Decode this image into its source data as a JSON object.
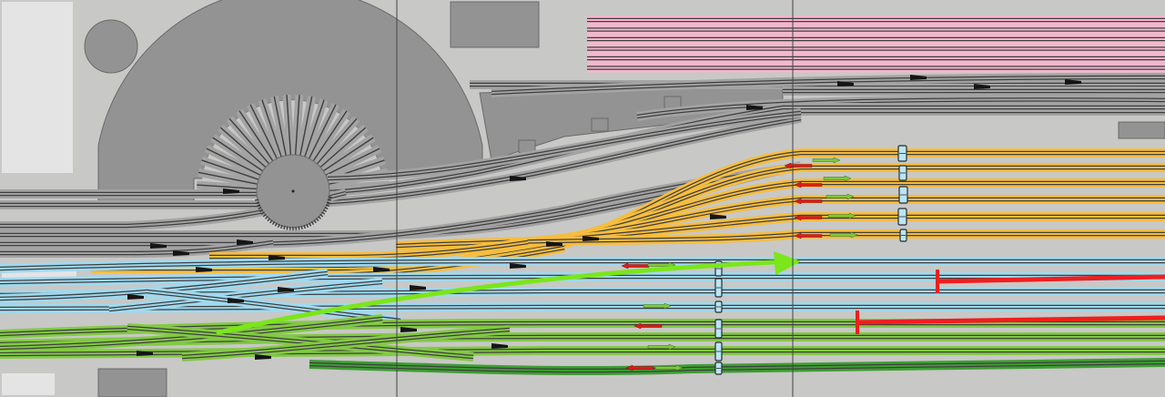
{
  "colors": {
    "background": "#c8c8c6",
    "building": "#939393",
    "building_light": "#e4e4e4",
    "building_stroke": "#6a6a6a",
    "track_gray_sleeper": "#a3a3a3",
    "track_gray_rail": "#3e3e3e",
    "track_pink_sleeper": "#f7b6cd",
    "track_orange_sleeper": "#f7bd3d",
    "track_blue_sleeper": "#9fd9ef",
    "track_green_sleeper": "#82c944",
    "track_darkgreen_sleeper": "#3e9e33",
    "switch_black": "#151515",
    "signal_red": "#e01a1a",
    "signal_green": "#7ec93a",
    "route_arrow": "#7be61a",
    "buffer_stop": "#f01e1e",
    "grid_line": "#444444"
  },
  "icons": {
    "turntable": "turntable-icon",
    "roundhouse": "roundhouse-icon",
    "signal_red": "signal-arrow-red-icon",
    "signal_green": "signal-arrow-green-icon",
    "buffer_stop": "buffer-stop-icon",
    "route": "route-arrow-icon",
    "train": "train-car-icon"
  },
  "layout": {
    "rail_pink_count": 6,
    "rail_gray_yard_count": 5,
    "rail_orange_count": 6,
    "rail_blue_count": 4,
    "rail_green_count": 4,
    "roundhouse_stall_count": 24
  }
}
